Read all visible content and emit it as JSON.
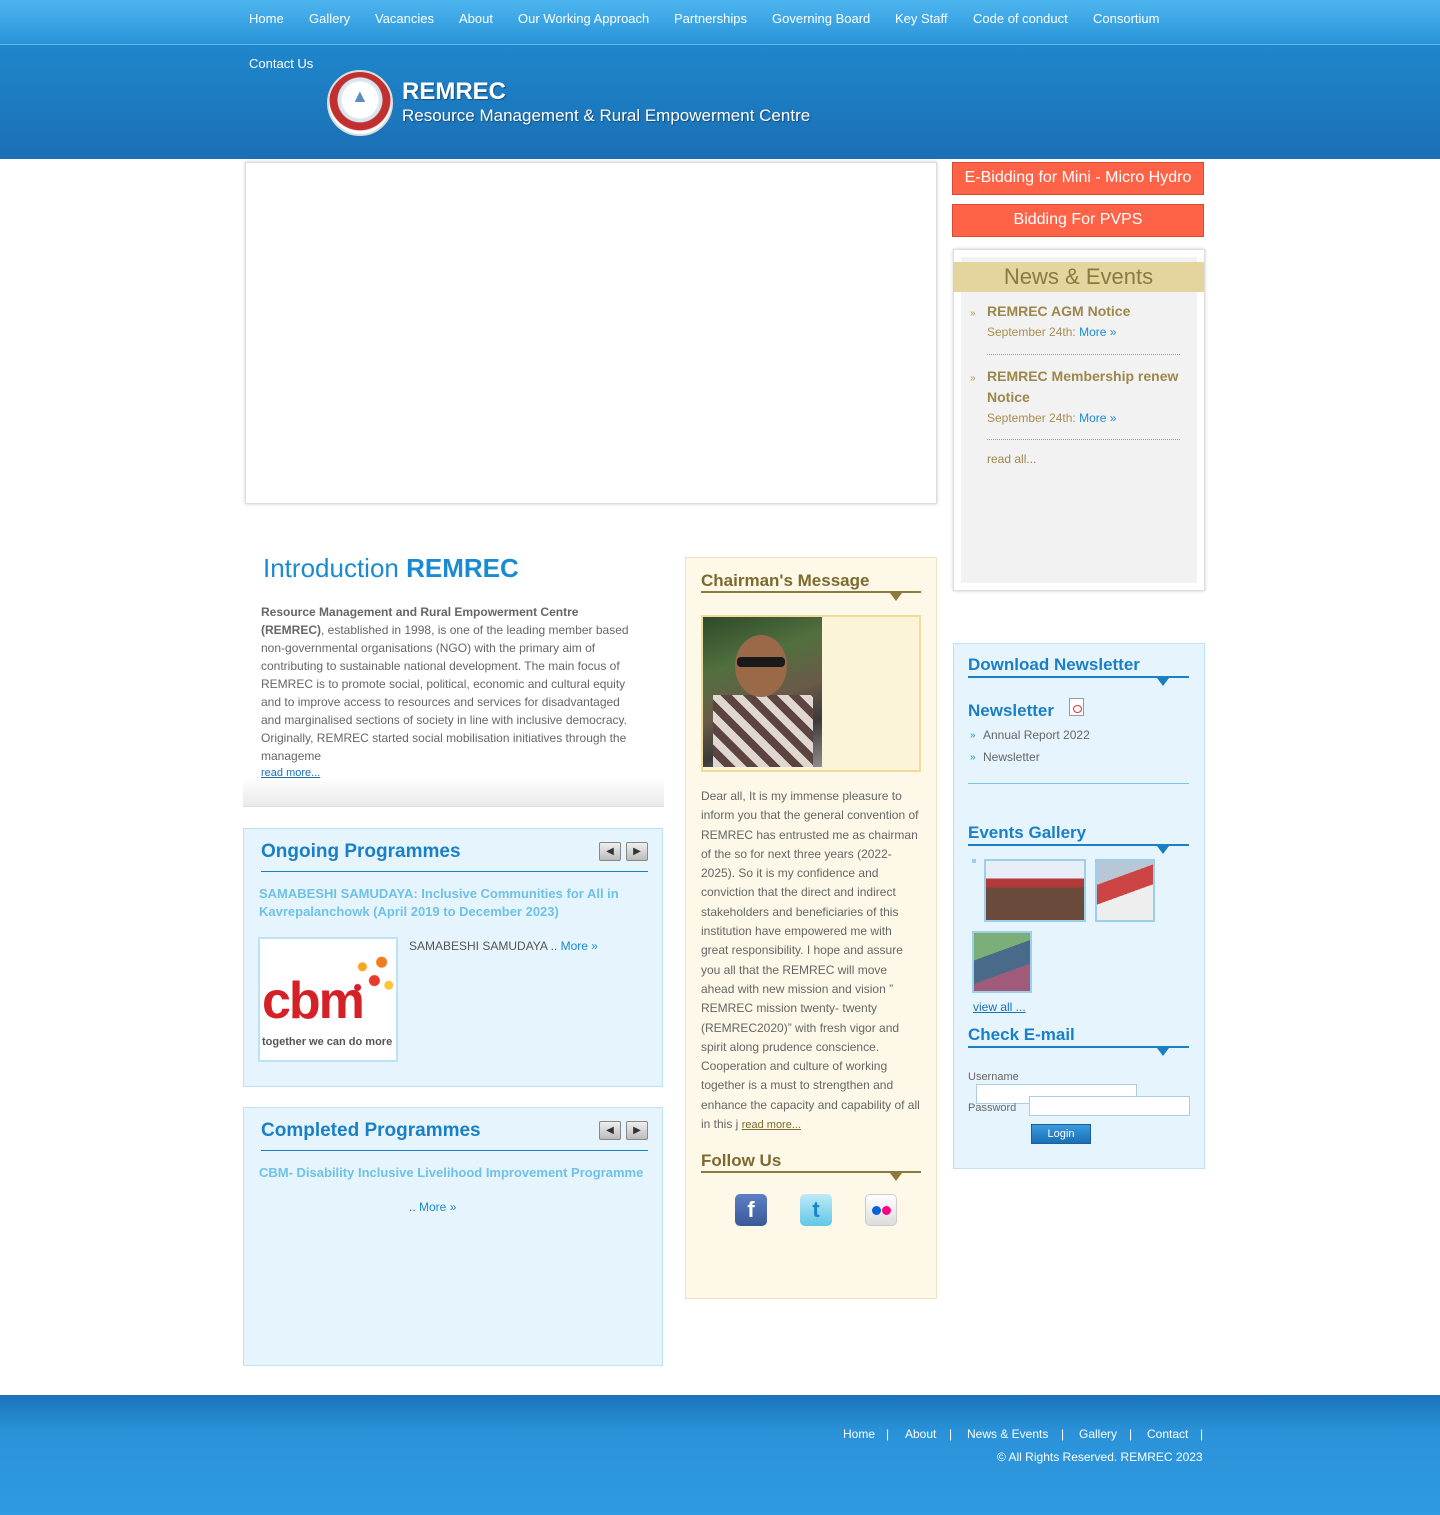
{
  "nav": {
    "items": [
      "Home",
      "Gallery",
      "Vacancies",
      "About",
      "Our Working Approach",
      "Partnerships",
      "Governing Board",
      "Key Staff",
      "Code of conduct",
      "Consortium",
      "Contact Us"
    ]
  },
  "brand": {
    "title": "REMREC",
    "subtitle": "Resource Management & Rural Empowerment Centre"
  },
  "notices": {
    "ebidding": "E-Bidding for Mini - Micro Hydro",
    "bidding_pvps": "Bidding For PVPS"
  },
  "news": {
    "heading": "News & Events",
    "items": [
      {
        "title": "REMREC AGM Notice",
        "date": "September 24th:",
        "more": "More »"
      },
      {
        "title": "REMREC Membership renew Notice",
        "date": "September 24th:",
        "more": "More »"
      }
    ],
    "read_all": "read all..."
  },
  "intro": {
    "title_prefix": "Introduction",
    "title_brand": "REMREC",
    "lead_bold": "Resource Management and Rural Empowerment Centre (REMREC)",
    "body": ", established in 1998, is one of the leading member based non-governmental organisations (NGO) with the primary aim of contributing to sustainable national development. The main focus of REMREC is to promote social, political, economic and cultural equity and to improve access to resources and services for disadvantaged and marginalised sections of society in line with inclusive democracy. Originally, REMREC started social mobilisation initiatives through the manageme",
    "read_more": "read more..."
  },
  "ongoing": {
    "heading": "Ongoing Programmes",
    "item_title": "SAMABESHI SAMUDAYA: Inclusive Communities for All in Kavrepalanchowk (April 2019 to December 2023)",
    "logo_text": "cbm",
    "logo_tagline": "together we can do more",
    "desc": "SAMABESHI SAMUDAYA ..",
    "more": "More »"
  },
  "completed": {
    "heading": "Completed Programmes",
    "item_title": "CBM- Disability Inclusive Livelihood Improvement Programme",
    "desc": "..",
    "more": "More »"
  },
  "chairman": {
    "heading": "Chairman's Message",
    "message": "Dear all, It is my immense pleasure to inform you that the general convention of REMREC has entrusted me as chairman of the so for next three years (2022-2025). So it is my confidence and conviction that the direct and indirect stakeholders and beneficiaries of this institution have empowered me with great responsibility. I hope and assure you all that the REMREC will move ahead with new mission and vision ” REMREC mission twenty- twenty (REMREC2020)” with fresh vigor and spirit along prudence conscience. Cooperation and culture of working together is a must to strengthen and enhance the capacity and capability of all in this j",
    "read_more": "read more..."
  },
  "follow": {
    "heading": "Follow Us",
    "icons": [
      "facebook-icon",
      "twitter-icon",
      "flickr-icon"
    ]
  },
  "newsletter": {
    "heading": "Download Newsletter",
    "sub_heading": "Newsletter",
    "items": [
      "Annual Report 2022",
      "Newsletter"
    ]
  },
  "gallery": {
    "heading": "Events Gallery",
    "view_all": "view all ..."
  },
  "email": {
    "heading": "Check E-mail",
    "username_label": "Username",
    "password_label": "Password",
    "login": "Login"
  },
  "footer": {
    "links": [
      "Home",
      "About",
      "News & Events",
      "Gallery",
      "Contact"
    ],
    "separator": "|",
    "copyright": "© All Rights Reserved. REMREC 2023"
  },
  "colors": {
    "header_blue": "#1a6fb5",
    "notice_red": "#ff6347",
    "gold": "#8a7a3c",
    "accent_blue": "#1a7fc5"
  }
}
